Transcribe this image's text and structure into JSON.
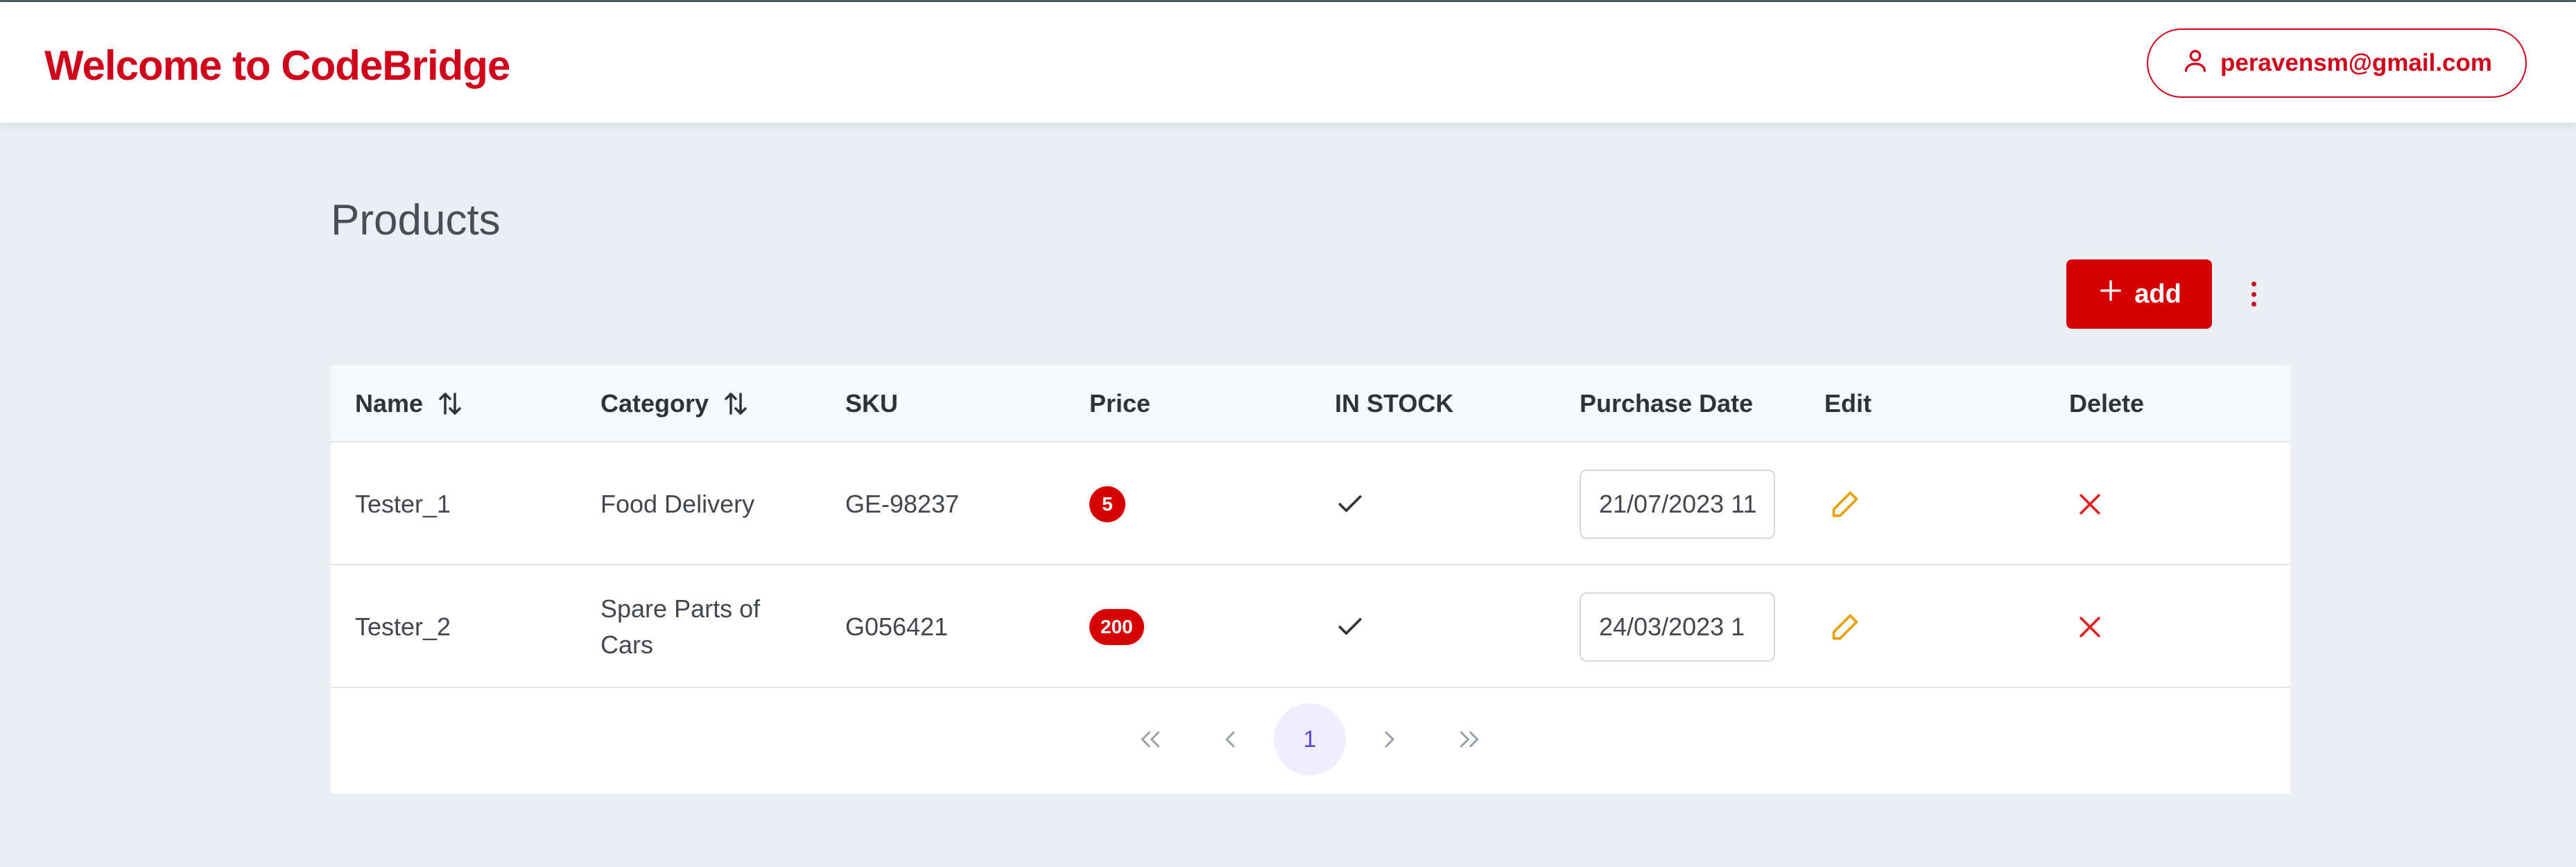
{
  "header": {
    "brand": "Welcome to CodeBridge",
    "user_email": "peravensm@gmail.com",
    "user_icon": "user-icon"
  },
  "page": {
    "title": "Products",
    "add_label": "add",
    "add_icon": "plus-icon",
    "menu_icon": "kebab-menu-icon"
  },
  "table": {
    "columns": {
      "name": "Name",
      "category": "Category",
      "sku": "SKU",
      "price": "Price",
      "in_stock": "IN STOCK",
      "purchase_date": "Purchase Date",
      "edit": "Edit",
      "delete": "Delete"
    },
    "rows": [
      {
        "name": "Tester_1",
        "category": "Food Delivery",
        "sku": "GE-98237",
        "price": "5",
        "in_stock": true,
        "purchase_date": "21/07/2023 11"
      },
      {
        "name": "Tester_2",
        "category": "Spare Parts of Cars",
        "sku": "G056421",
        "price": "200",
        "in_stock": true,
        "purchase_date": "24/03/2023 1"
      }
    ]
  },
  "pagination": {
    "current_page": "1"
  },
  "colors": {
    "brand_red": "#D0021B",
    "button_red": "#D60000",
    "edit_orange": "#E6A100",
    "delete_red": "#E02424",
    "page_active": "#5B4BD6"
  }
}
